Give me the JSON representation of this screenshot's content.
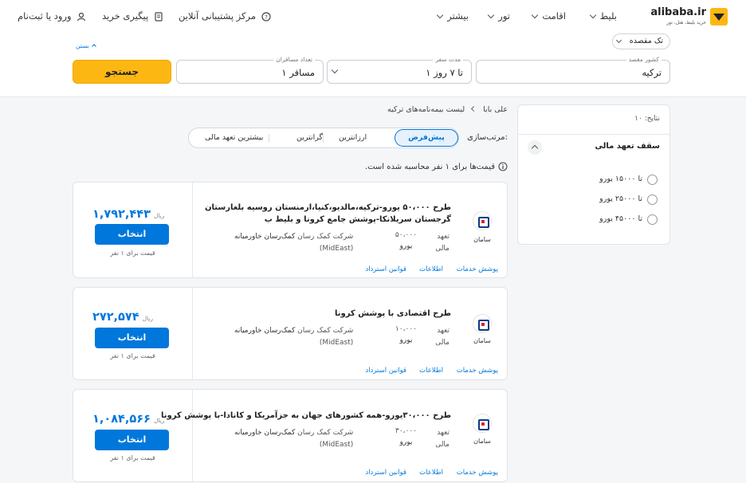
{
  "brand": {
    "logo_text": "alibaba.ir",
    "tagline": "خرید بلیط، هتل، تور"
  },
  "nav": {
    "items": [
      {
        "label": "بلیط"
      },
      {
        "label": "اقامت"
      },
      {
        "label": "تور"
      },
      {
        "label": "بیشتر"
      }
    ],
    "support_label": "مرکز پشتیبانی آنلاین",
    "track_label": "پیگیری خرید",
    "login_label": "ورود یا ثبت‌نام"
  },
  "search": {
    "trip_type": "تک مقصده",
    "collapse_label": "بستن",
    "destination_label": "کشور مقصد",
    "destination_value": "ترکیه",
    "duration_label": "مدت سفر",
    "duration_value": "۱ تا ۷ روز",
    "travelers_label": "تعداد مسافران",
    "travelers_value": "۱ مسافر",
    "search_button": "جستجو"
  },
  "breadcrumb": {
    "home": "علی بابا",
    "current": "لیست بیمه‌نامه‌های ترکیه"
  },
  "sort": {
    "label": "مرتب‌سازی:",
    "options": [
      "پیش‌فرض",
      "ارزانترین",
      "گرانترین",
      "بیشترین تعهد مالی"
    ]
  },
  "notice": "قیمت‌ها برای ۱ نفر محاسبه شده است.",
  "filters": {
    "results": "نتایج: ۱۰",
    "cap_title": "سقف تعهد مالی",
    "options": [
      "تا ۱۵۰۰۰ یورو",
      "تا ۲۵۰۰۰ یورو",
      "تا ۴۵۰۰۰ یورو"
    ]
  },
  "card_common": {
    "currency": "ریال",
    "select_label": "انتخاب",
    "per_person": "قیمت برای ۱ نفر",
    "commitment_label_1": "تعهد",
    "commitment_label_2": "مالی",
    "insurer": "سامان",
    "company_prefix": "شرکت کمک رسان",
    "company_name": "کمک‌رسان خاورمیانه",
    "company_code": "(MidEast)",
    "link_services": "پوشش خدمات",
    "link_info": "اطلاعات",
    "link_refund": "قوانین استرداد",
    "unit": "یورو"
  },
  "plans": [
    {
      "title": "طرح ۵۰،۰۰۰ یورو-ترکیه،مالدیو،کنیا،ارمنستان روسیه بلغارستان گرجستان سریلانکا-پوشش جامع کرونا و بلیط ب",
      "price": "۱,۷۹۲,۴۴۳",
      "commitment": "۵۰،۰۰۰"
    },
    {
      "title": "طرح اقتصادی با پوشش کرونا",
      "price": "۲۷۲,۵۷۴",
      "commitment": "۱۰،۰۰۰"
    },
    {
      "title": "طرح ۳۰،۰۰۰یورو-همه کشورهای جهان به جزآمریکا و کانادا-با پوشش کرونا",
      "price": "۱,۰۸۴,۵۶۶",
      "commitment": "۳۰،۰۰۰"
    }
  ]
}
